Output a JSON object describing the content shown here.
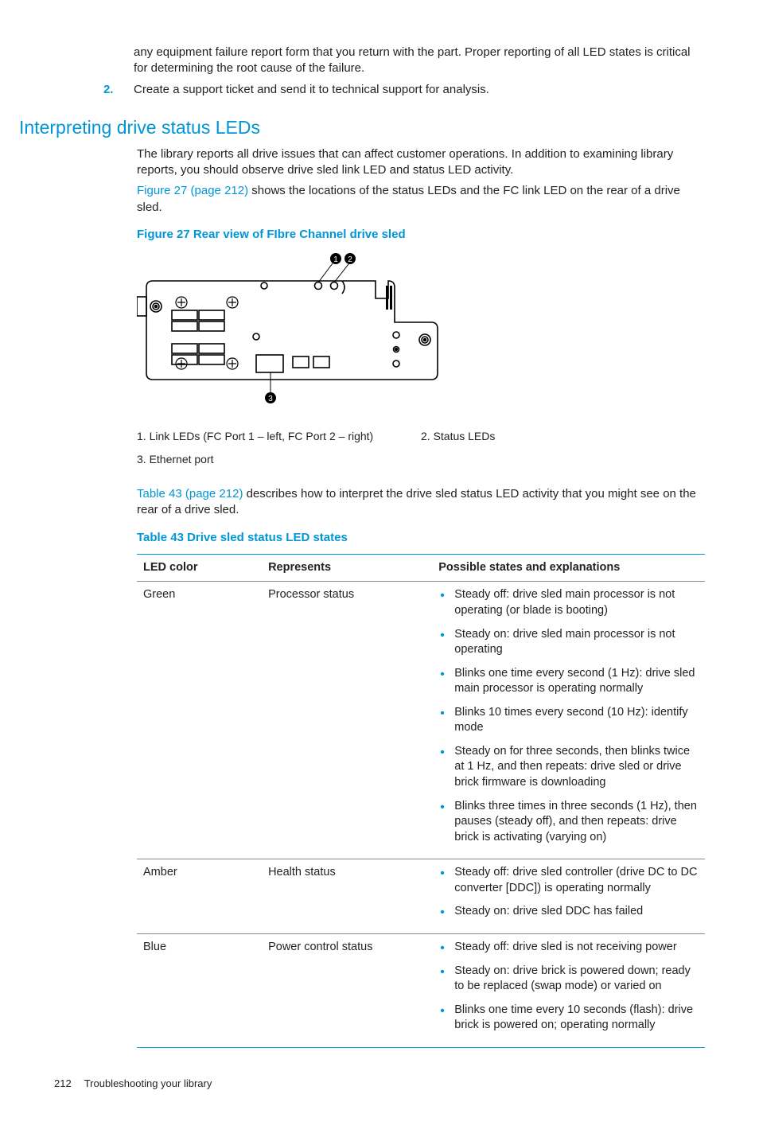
{
  "intro_continued": "any equipment failure report form that you return with the part. Proper reporting of all LED states is critical for determining the root cause of the failure.",
  "step2_num": "2.",
  "step2_text": "Create a support ticket and send it to technical support for analysis.",
  "section_title": "Interpreting drive status LEDs",
  "para1": "The library reports all drive issues that can affect customer operations. In addition to examining library reports, you should observe drive sled link LED and status LED activity.",
  "link_fig": "Figure 27 (page 212)",
  "para2_rest": " shows the locations of the status LEDs and the FC link LED on the rear of a drive sled.",
  "figure_caption": "Figure 27 Rear view of FIbre Channel drive sled",
  "legend": {
    "l1": "1. Link LEDs (FC Port 1 – left, FC Port 2 – right)",
    "l2": "2. Status LEDs",
    "l3": "3. Ethernet port"
  },
  "link_tbl": "Table 43 (page 212)",
  "para3_rest": " describes how to interpret the drive sled status LED activity that you might see on the rear of a drive sled.",
  "table_caption": "Table 43 Drive sled status LED states",
  "table": {
    "h1": "LED color",
    "h2": "Represents",
    "h3": "Possible states and explanations",
    "rows": [
      {
        "color": "Green",
        "rep": "Processor status",
        "states": [
          "Steady off: drive sled main processor is not operating (or blade is booting)",
          "Steady on: drive sled main processor is not operating",
          "Blinks one time every second (1 Hz): drive sled main processor is operating normally",
          "Blinks 10 times every second (10 Hz): identify mode",
          "Steady on for three seconds, then blinks twice at 1 Hz, and then repeats: drive sled or drive brick firmware is downloading",
          "Blinks three times in three seconds (1 Hz), then pauses (steady off), and then repeats: drive brick is activating (varying on)"
        ]
      },
      {
        "color": "Amber",
        "rep": "Health status",
        "states": [
          "Steady off: drive sled controller (drive DC to DC converter [DDC]) is operating normally",
          "Steady on: drive sled DDC has failed"
        ]
      },
      {
        "color": "Blue",
        "rep": "Power control status",
        "states": [
          "Steady off: drive sled is not receiving power",
          "Steady on: drive brick is powered down; ready to be replaced (swap mode) or varied on",
          "Blinks one time every 10 seconds (flash): drive brick is powered on; operating normally"
        ]
      }
    ]
  },
  "footer": {
    "page": "212",
    "title": "Troubleshooting your library"
  }
}
